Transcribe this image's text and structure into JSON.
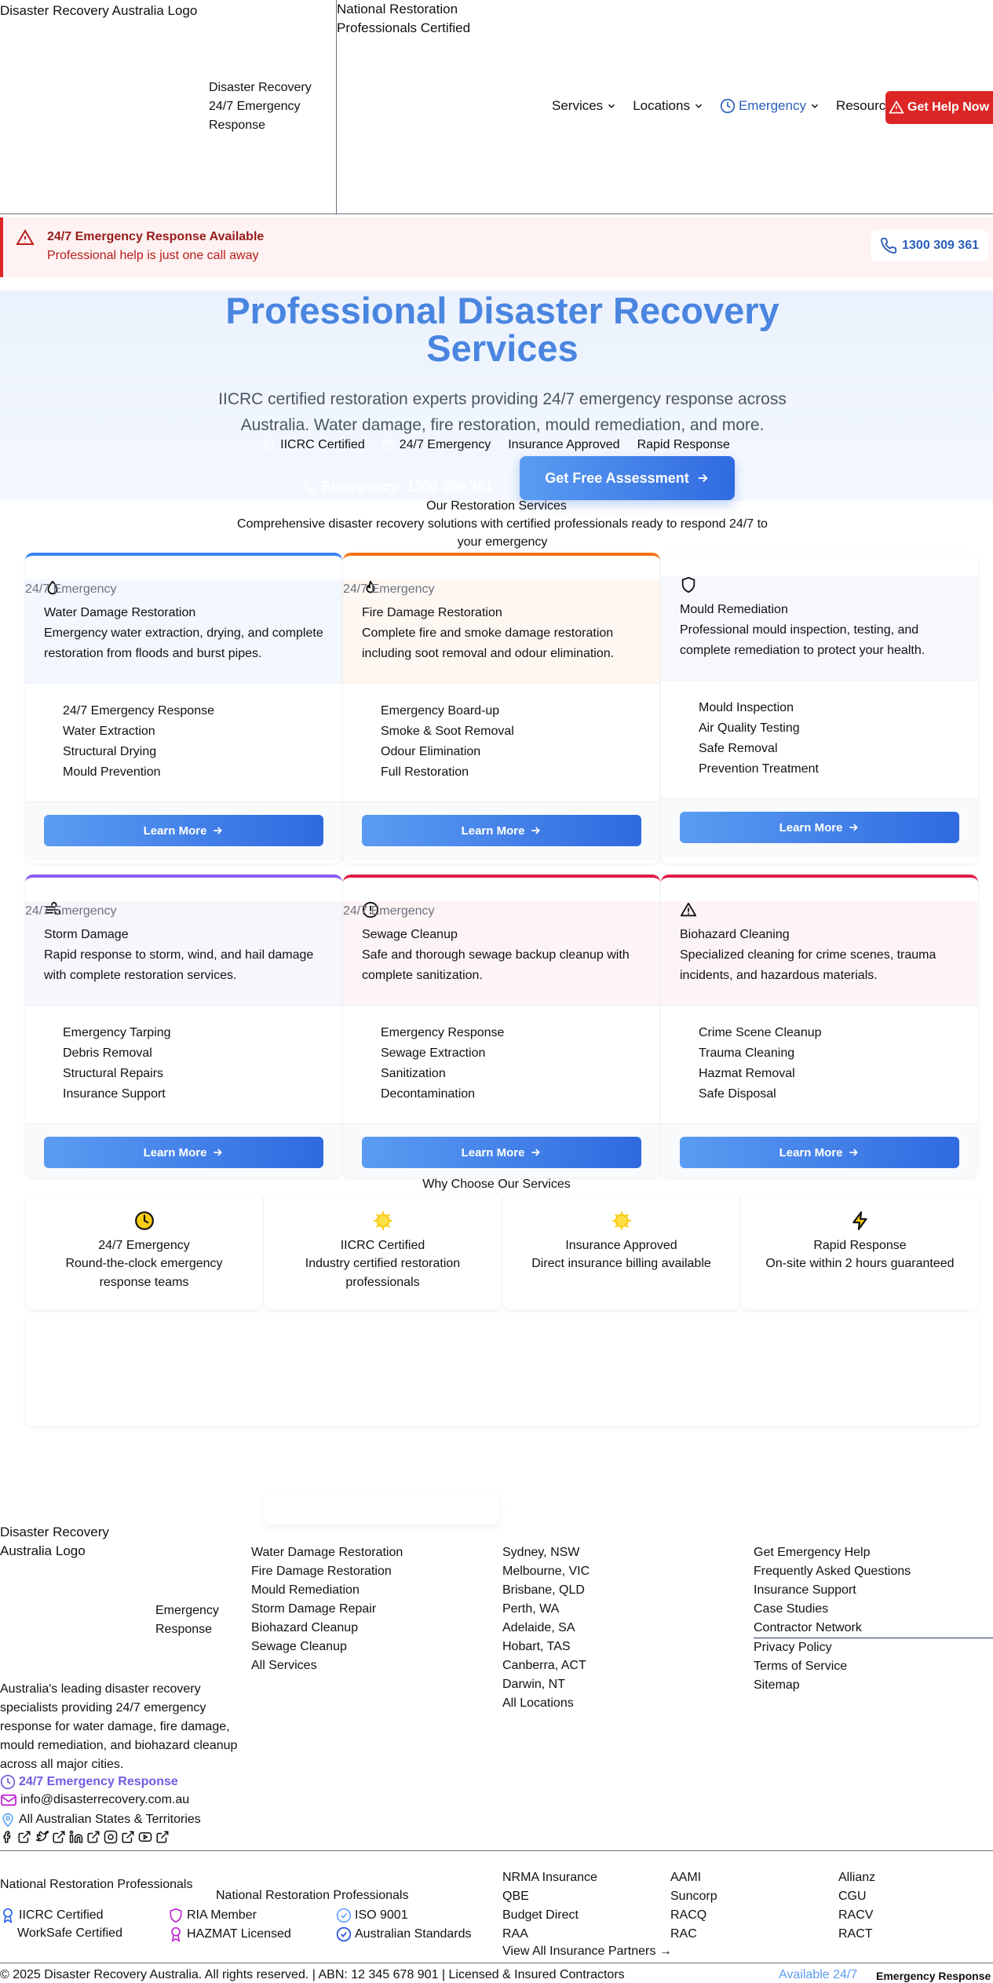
{
  "header": {
    "logo_alt": "Disaster Recovery Australia Logo",
    "brand_line1": "Disaster Recovery",
    "brand_line2": "24/7 Emergency",
    "brand_line3": "Response",
    "cert_alt": "National Restoration Professionals Certified",
    "nav": [
      "Services",
      "Locations",
      "Emergency",
      "Resources"
    ],
    "help_button": "Get Help Now"
  },
  "alert": {
    "title": "24/7 Emergency Response Available",
    "subtitle": "Professional help is just one call away",
    "phone": "1300 309 361"
  },
  "hero": {
    "title": "Professional Disaster Recovery Services",
    "subtitle": "IICRC certified restoration experts providing 24/7 emergency response across Australia. Water damage, fire restoration, mould remediation, and more.",
    "badges": [
      "IICRC Certified",
      "24/7 Emergency",
      "Insurance Approved",
      "Rapid Response"
    ],
    "emergency_cta": "Emergency: 1300 309 361",
    "assessment_cta": "Get Free Assessment"
  },
  "services": {
    "heading": "Our Restoration Services",
    "subheading": "Comprehensive disaster recovery solutions with certified professionals ready to respond 24/7 to your emergency",
    "learn_more": "Learn More",
    "cards": [
      {
        "tag": "24/7 Emergency",
        "icon": "droplet-icon",
        "accent": "#3b82f6",
        "tint": "#f3f7fe",
        "title": "Water Damage Restoration",
        "desc": "Emergency water extraction, drying, and complete restoration from floods and burst pipes.",
        "items": [
          "24/7 Emergency Response",
          "Water Extraction",
          "Structural Drying",
          "Mould Prevention"
        ]
      },
      {
        "tag": "24/7 Emergency",
        "icon": "flame-icon",
        "accent": "#f97316",
        "tint": "#fff8f2",
        "title": "Fire Damage Restoration",
        "desc": "Complete fire and smoke damage restoration including soot removal and odour elimination.",
        "items": [
          "Emergency Board-up",
          "Smoke & Soot Removal",
          "Odour Elimination",
          "Full Restoration"
        ]
      },
      {
        "tag": "",
        "icon": "shield-icon",
        "accent": "",
        "tint": "#f6f8fc",
        "title": "Mould Remediation",
        "desc": "Professional mould inspection, testing, and complete remediation to protect your health.",
        "items": [
          "Mould Inspection",
          "Air Quality Testing",
          "Safe Removal",
          "Prevention Treatment"
        ]
      },
      {
        "tag": "24/7 Emergency",
        "icon": "wind-icon",
        "accent": "#8b5cf6",
        "tint": "#f7f6fd",
        "title": "Storm Damage",
        "desc": "Rapid response to storm, wind, and hail damage with complete restoration services.",
        "items": [
          "Emergency Tarping",
          "Debris Removal",
          "Structural Repairs",
          "Insurance Support"
        ]
      },
      {
        "tag": "24/7 Emergency",
        "icon": "alert-circle-icon",
        "accent": "#e11d48",
        "tint": "#fdf4f5",
        "title": "Sewage Cleanup",
        "desc": "Safe and thorough sewage backup cleanup with complete sanitization.",
        "items": [
          "Emergency Response",
          "Sewage Extraction",
          "Sanitization",
          "Decontamination"
        ]
      },
      {
        "tag": "",
        "icon": "warning-triangle-icon",
        "accent": "#e11d48",
        "tint": "#fdf4f5",
        "title": "Biohazard Cleaning",
        "desc": "Specialized cleaning for crime scenes, trauma incidents, and hazardous materials.",
        "items": [
          "Crime Scene Cleanup",
          "Trauma Cleaning",
          "Hazmat Removal",
          "Safe Disposal"
        ]
      }
    ]
  },
  "why": {
    "heading": "Why Choose Our Services",
    "items": [
      {
        "icon": "clock-icon",
        "title": "24/7 Emergency",
        "desc": "Round-the-clock emergency response teams"
      },
      {
        "icon": "award-icon",
        "title": "IICRC Certified",
        "desc": "Industry certified restoration professionals"
      },
      {
        "icon": "badge-check-icon",
        "title": "Insurance Approved",
        "desc": "Direct insurance billing available"
      },
      {
        "icon": "lightning-icon",
        "title": "Rapid Response",
        "desc": "On-site within 2 hours guaranteed"
      }
    ]
  },
  "footer": {
    "logo_alt": "Disaster Recovery Australia Logo",
    "tagline_line1": "Emergency",
    "tagline_line2": "Response",
    "about": "Australia's leading disaster recovery specialists providing 24/7 emergency response for water damage, fire damage, mould remediation, and biohazard cleanup across all major cities.",
    "contact_emergency": "24/7 Emergency Response",
    "contact_email": "info@disasterrecovery.com.au",
    "contact_area": "All Australian States & Territories",
    "services": [
      "Water Damage Restoration",
      "Fire Damage Restoration",
      "Mould Remediation",
      "Storm Damage Repair",
      "Biohazard Cleanup",
      "Sewage Cleanup",
      "All Services"
    ],
    "locations": [
      "Sydney, NSW",
      "Melbourne, VIC",
      "Brisbane, QLD",
      "Perth, WA",
      "Adelaide, SA",
      "Hobart, TAS",
      "Canberra, ACT",
      "Darwin, NT",
      "All Locations"
    ],
    "resources": [
      "Get Emergency Help",
      "Frequently Asked Questions",
      "Insurance Support",
      "Case Studies",
      "Contractor Network",
      "Privacy Policy",
      "Terms of Service",
      "Sitemap"
    ],
    "cert_logo_alt": "National Restoration Professionals",
    "cert_name": "National Restoration Professionals",
    "certs": [
      "IICRC Certified",
      "RIA Member",
      "ISO 9001",
      "WorkSafe Certified",
      "HAZMAT Licensed",
      "Australian Standards"
    ],
    "partners_col1": [
      "NRMA Insurance",
      "QBE",
      "Budget Direct",
      "RAA"
    ],
    "partners_col2": [
      "AAMI",
      "Suncorp",
      "RACQ",
      "RAC"
    ],
    "partners_col3": [
      "Allianz",
      "CGU",
      "RACV",
      "RACT"
    ],
    "view_partners": "View All Insurance Partners →",
    "copyright": "© 2025 Disaster Recovery Australia. All rights reserved.",
    "abn": "ABN: 12 345 678 901",
    "licensed": "Licensed & Insured Contractors",
    "available": "Available 24/7",
    "emergency_response": "Emergency Response"
  }
}
